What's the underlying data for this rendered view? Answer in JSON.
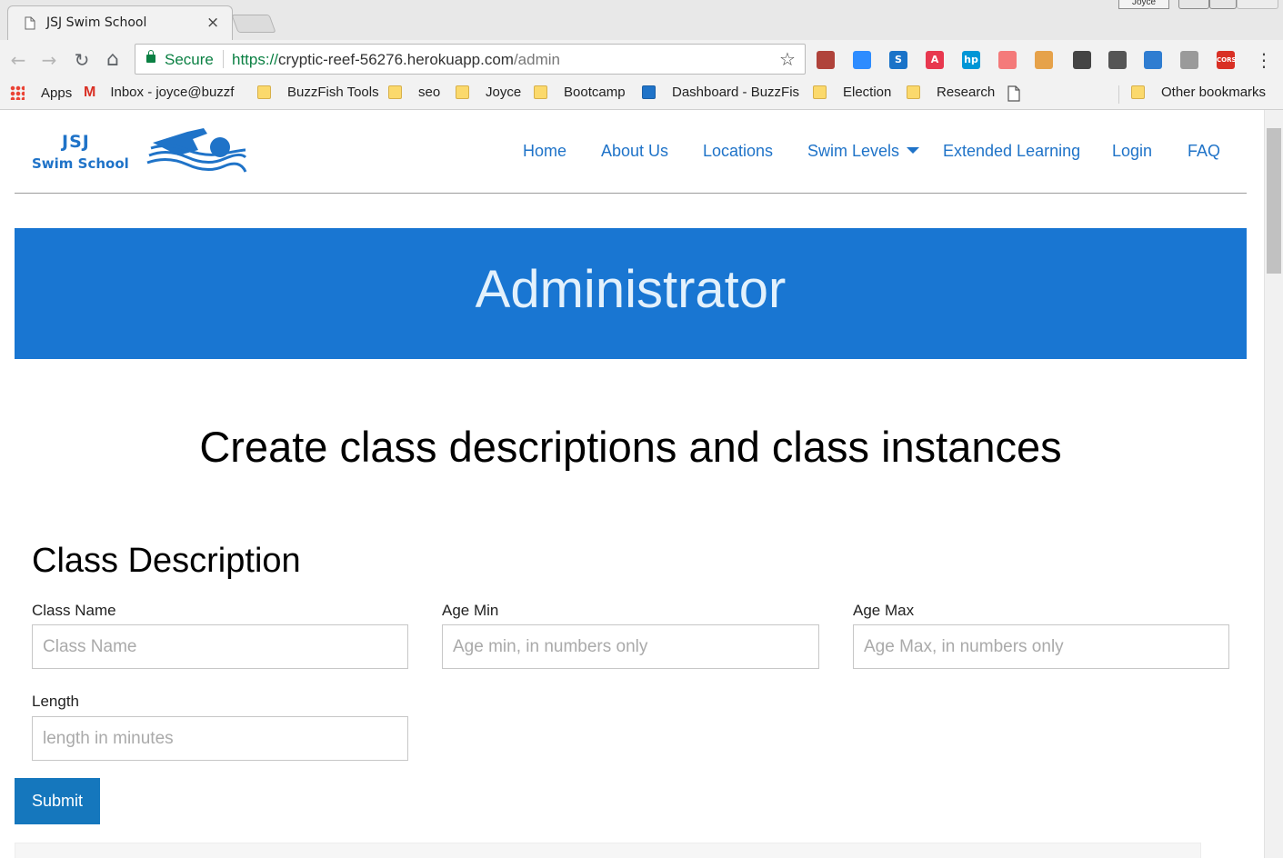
{
  "browser": {
    "tab_title": "JSJ Swim School",
    "tab_close": "×",
    "profile_name": "Joyce",
    "secure_label": "Secure",
    "url_scheme": "https://",
    "url_host": "cryptic-reef-56276.herokuapp.com",
    "url_path": "/admin",
    "nav_back": "←",
    "nav_forward": "→",
    "nav_reload": "↻",
    "nav_home": "⌂",
    "star": "☆",
    "menu": "⋮",
    "extensions": [
      {
        "icon": "acrobat-icon",
        "glyph": "",
        "color": "#b0433b"
      },
      {
        "icon": "zoom-icon",
        "glyph": "",
        "color": "#2d8cff"
      },
      {
        "icon": "s-icon",
        "glyph": "S",
        "color": "#1a73c8"
      },
      {
        "icon": "a-icon",
        "glyph": "A",
        "color": "#e8384f"
      },
      {
        "icon": "hp-icon",
        "glyph": "hp",
        "color": "#0096d6"
      },
      {
        "icon": "arrow-ext-icon",
        "glyph": "",
        "color": "#f47a7a"
      },
      {
        "icon": "wrench-icon",
        "glyph": "",
        "color": "#e6a24a"
      },
      {
        "icon": "eyedropper-icon",
        "glyph": "",
        "color": "#444444"
      },
      {
        "icon": "screenshot-icon",
        "glyph": "",
        "color": "#555555"
      },
      {
        "icon": "swap-icon",
        "glyph": "",
        "color": "#2f7dd1"
      },
      {
        "icon": "json-icon",
        "glyph": "",
        "color": "#9a9a9a"
      },
      {
        "icon": "cors-icon",
        "glyph": "CORS",
        "color": "#d93025"
      }
    ],
    "bookmarks": {
      "apps": "Apps",
      "inbox": "Inbox - joyce@buzzf",
      "buzzfish_tools": "BuzzFish Tools",
      "seo": "seo",
      "joyce": "Joyce",
      "bootcamp": "Bootcamp",
      "dashboard": "Dashboard - BuzzFis",
      "election": "Election",
      "research": "Research",
      "other": "Other bookmarks"
    }
  },
  "site": {
    "logo_line1": "JSJ",
    "logo_line2": "Swim School",
    "nav": {
      "home": "Home",
      "about": "About Us",
      "locations": "Locations",
      "swim_levels": "Swim Levels",
      "extended_learning": "Extended Learning",
      "login": "Login",
      "faq": "FAQ"
    },
    "hero_title": "Administrator",
    "subtitle": "Create class descriptions and class instances",
    "form": {
      "section_title": "Class Description",
      "class_name_label": "Class Name",
      "class_name_placeholder": "Class Name",
      "age_min_label": "Age Min",
      "age_min_placeholder": "Age min, in numbers only",
      "age_max_label": "Age Max",
      "age_max_placeholder": "Age Max, in numbers only",
      "length_label": "Length",
      "length_placeholder": "length in minutes",
      "submit_label": "Submit"
    },
    "colors": {
      "brand_blue": "#1f73c8",
      "hero_bg": "#1976d2",
      "submit_bg": "#1577bd"
    }
  }
}
